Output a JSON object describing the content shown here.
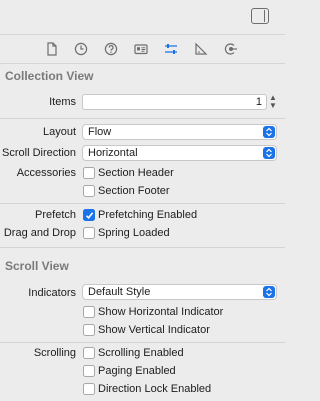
{
  "colors": {
    "accent": "#1a73e8",
    "section_title": "#7a7a7a",
    "background": "#ececec"
  },
  "toolbar": {
    "panel_toggle_icon": "right-sidebar-icon"
  },
  "tabs": [
    {
      "icon": "file-icon",
      "active": false
    },
    {
      "icon": "history-clock-icon",
      "active": false
    },
    {
      "icon": "help-icon",
      "active": false
    },
    {
      "icon": "identity-card-icon",
      "active": false
    },
    {
      "icon": "attributes-sliders-icon",
      "active": true
    },
    {
      "icon": "size-ruler-icon",
      "active": false
    },
    {
      "icon": "connections-arrow-icon",
      "active": false
    }
  ],
  "collection_view": {
    "title": "Collection View",
    "items_label": "Items",
    "items_value": "1",
    "layout_label": "Layout",
    "layout_value": "Flow",
    "scroll_direction_label": "Scroll Direction",
    "scroll_direction_value": "Horizontal",
    "accessories_label": "Accessories",
    "section_header_label": "Section Header",
    "section_header_checked": false,
    "section_footer_label": "Section Footer",
    "section_footer_checked": false,
    "prefetch_label": "Prefetch",
    "prefetching_enabled_label": "Prefetching Enabled",
    "prefetching_enabled_checked": true,
    "drag_drop_label": "Drag and Drop",
    "spring_loaded_label": "Spring Loaded",
    "spring_loaded_checked": false
  },
  "scroll_view": {
    "title": "Scroll View",
    "indicators_label": "Indicators",
    "indicators_value": "Default Style",
    "show_horizontal_label": "Show Horizontal Indicator",
    "show_horizontal_checked": false,
    "show_vertical_label": "Show Vertical Indicator",
    "show_vertical_checked": false,
    "scrolling_label": "Scrolling",
    "scrolling_enabled_label": "Scrolling Enabled",
    "scrolling_enabled_checked": false,
    "paging_enabled_label": "Paging Enabled",
    "paging_enabled_checked": false,
    "direction_lock_label": "Direction Lock Enabled",
    "direction_lock_checked": false
  }
}
